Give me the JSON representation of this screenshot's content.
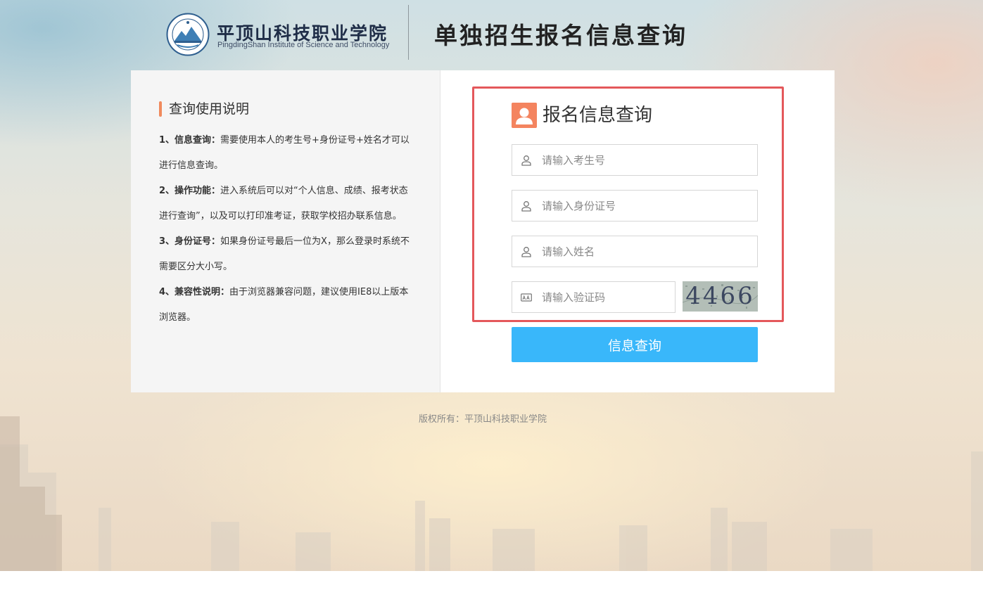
{
  "header": {
    "school_name_cn": "平顶山科技职业学院",
    "school_name_en": "PingdingShan Institute of Science and Technology",
    "page_title": "单独招生报名信息查询"
  },
  "instructions": {
    "title": "查询使用说明",
    "items": [
      {
        "label": "1、信息查询：",
        "text": "需要使用本人的考生号+身份证号+姓名才可以进行信息查询。"
      },
      {
        "label": "2、操作功能：",
        "text": "进入系统后可以对“个人信息、成绩、报考状态进行查询”，以及可以打印准考证，获取学校招办联系信息。"
      },
      {
        "label": "3、身份证号：",
        "text": "如果身份证号最后一位为X，那么登录时系统不需要区分大小写。"
      },
      {
        "label": "4、兼容性说明：",
        "text": "由于浏览器兼容问题，建议使用IE8以上版本浏览器。"
      }
    ]
  },
  "form": {
    "heading": "报名信息查询",
    "exam_number_placeholder": "请输入考生号",
    "id_number_placeholder": "请输入身份证号",
    "name_placeholder": "请输入姓名",
    "captcha_placeholder": "请输入验证码",
    "captcha_code": "4466",
    "submit_label": "信息查询"
  },
  "footer": {
    "copyright": "版权所有：平顶山科技职业学院"
  },
  "colors": {
    "accent_orange": "#f4845f",
    "button_blue": "#39b7fa",
    "highlight_red": "#e4585b"
  }
}
